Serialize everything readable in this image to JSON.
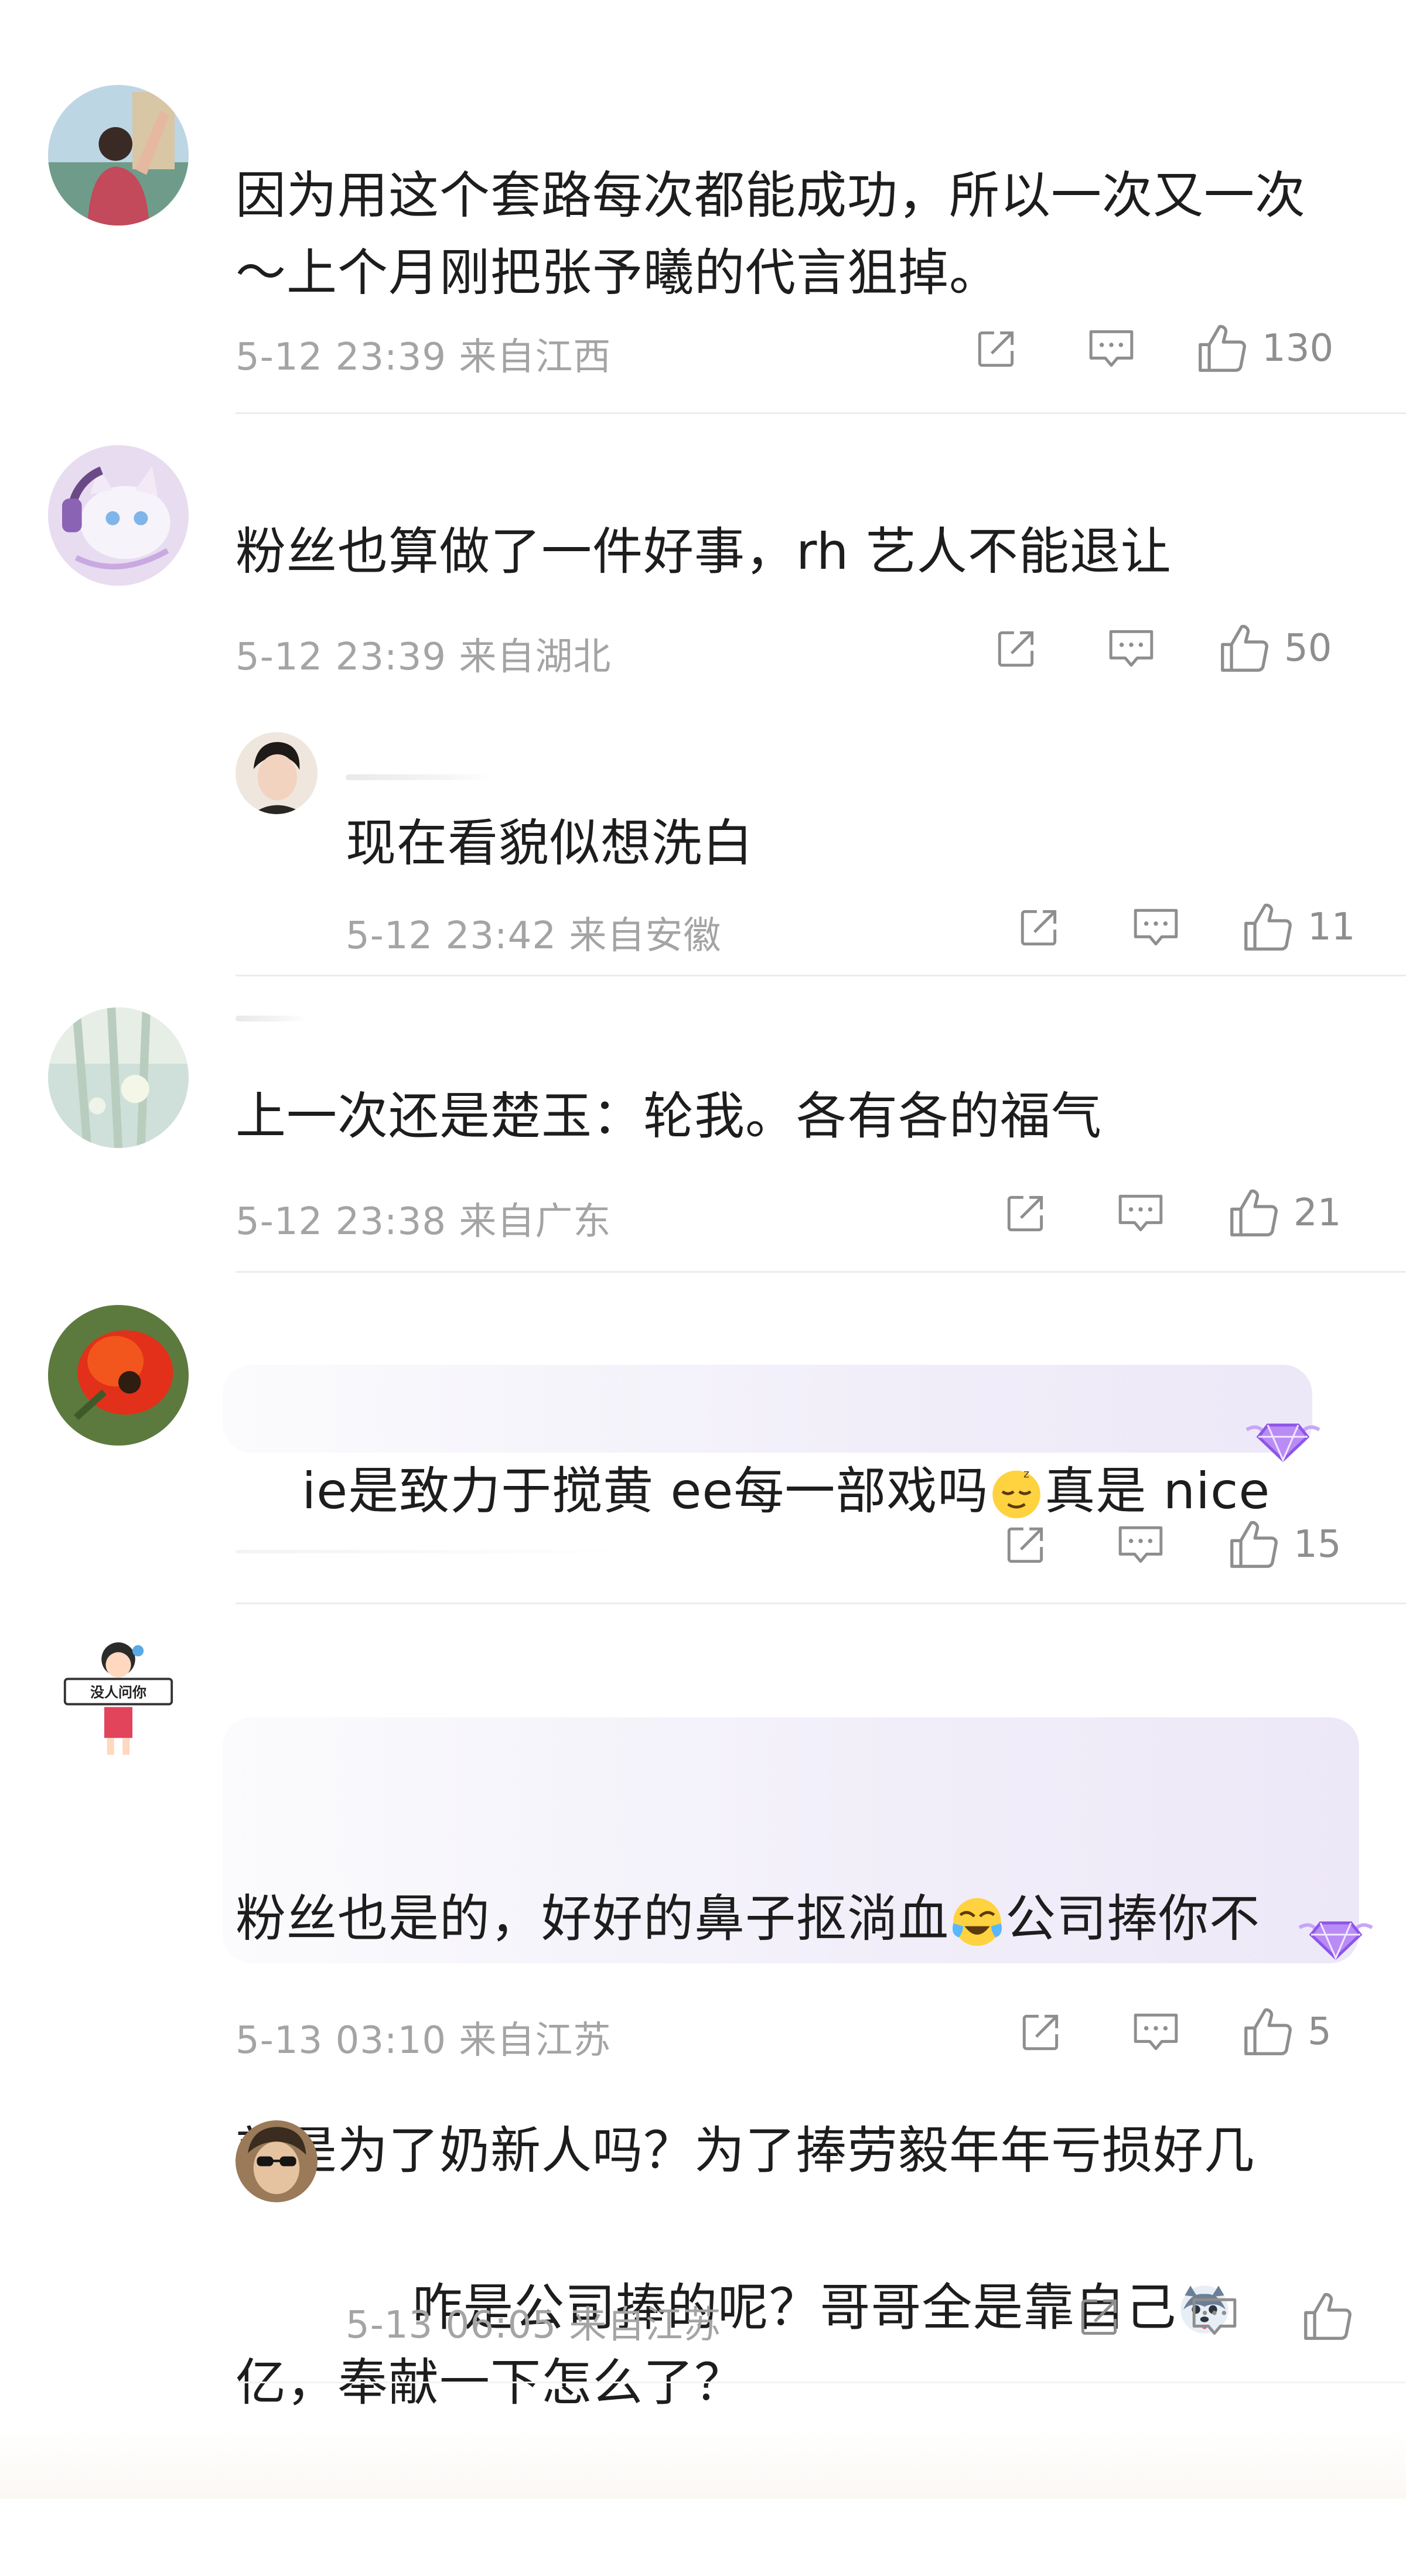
{
  "comments": [
    {
      "text": "因为用这个套路每次都能成功，所以一次又一次\n～上个月刚把张予曦的代言狙掉。",
      "meta": "5-12 23:39  来自江西",
      "likes": "130"
    },
    {
      "text": "粉丝也算做了一件好事，rh 艺人不能退让",
      "meta": "5-12 23:39  来自湖北",
      "likes": "50"
    },
    {
      "text": "现在看貌似想洗白",
      "meta": "5-12 23:42  来自安徽",
      "likes": "11"
    },
    {
      "text": "上一次还是楚玉：轮我。各有各的福气",
      "meta": "5-12 23:38  来自广东",
      "likes": "21"
    },
    {
      "text_a": "ie是致力于搅黄 ee每一部戏吗",
      "text_b": "真是 nice",
      "likes": "15"
    },
    {
      "line1_a": "粉丝也是的，好好的鼻子抠淌血",
      "line1_b": "公司捧你不",
      "line2": "就是为了奶新人吗？为了捧劳毅年年亏损好几",
      "line3": "亿，奉献一下怎么了？",
      "meta": "5-13 03:10  来自江苏",
      "likes": "5",
      "avatar_sign": "没人问你"
    },
    {
      "text": "咋是公司捧的呢？哥哥全是靠自己",
      "meta": "5-13 06:05  来自江苏",
      "likes": ""
    }
  ],
  "icons": {
    "share": "share-icon",
    "reply": "comment-icon",
    "like": "thumbs-up-icon"
  },
  "colors": {
    "text": "#1d1d1d",
    "meta": "#a4a4a4",
    "icon": "#8e8e8e",
    "divider": "#ececec",
    "badge": "#9b6cf0"
  }
}
